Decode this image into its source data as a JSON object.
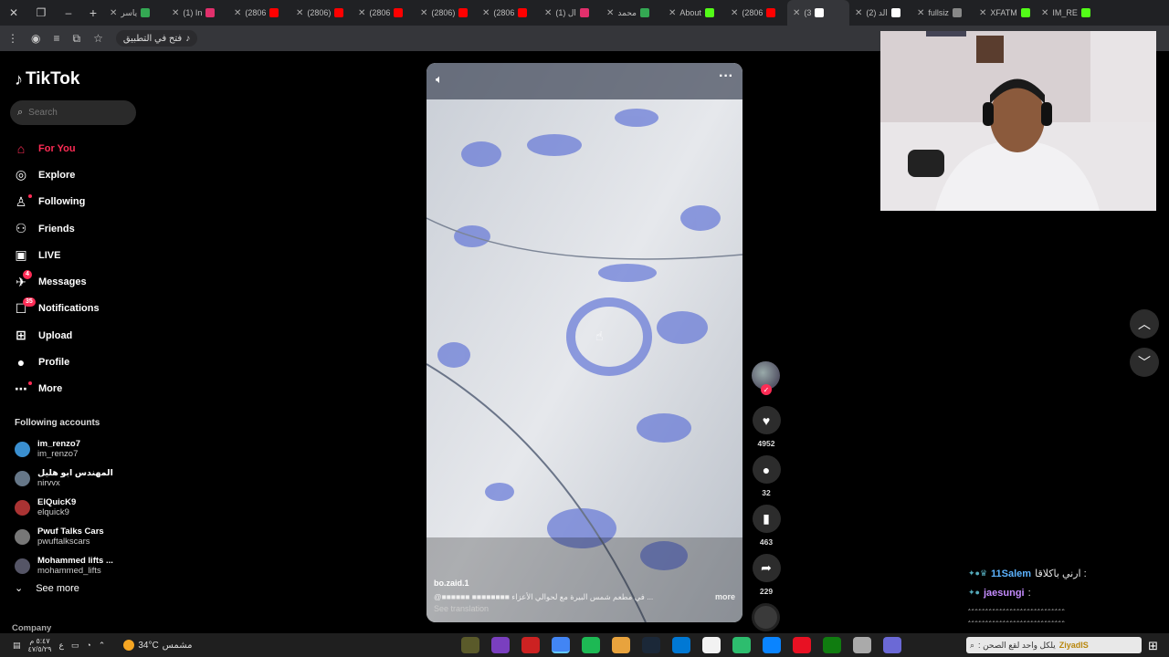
{
  "browser": {
    "tabs": [
      {
        "title": "ياسر",
        "favicon_color": "#34a853"
      },
      {
        "title": "(1) In",
        "favicon_color": "#e1306c"
      },
      {
        "title": "(2806",
        "favicon_color": "#ff0000"
      },
      {
        "title": "(2806)",
        "favicon_color": "#ff0000"
      },
      {
        "title": "(2806",
        "favicon_color": "#ff0000"
      },
      {
        "title": "(2806)",
        "favicon_color": "#ff0000"
      },
      {
        "title": "(2806",
        "favicon_color": "#ff0000"
      },
      {
        "title": "(1) ال",
        "favicon_color": "#e1306c"
      },
      {
        "title": "محمد",
        "favicon_color": "#34a853"
      },
      {
        "title": "About",
        "favicon_color": "#53fc18"
      },
      {
        "title": "(2806",
        "favicon_color": "#ff0000"
      },
      {
        "title": "(3",
        "favicon_color": "#ffffff",
        "active": true
      },
      {
        "title": "(2) الد",
        "favicon_color": "#ffffff"
      },
      {
        "title": "fullsiz",
        "favicon_color": "#888888"
      },
      {
        "title": "XFATM",
        "favicon_color": "#53fc18"
      },
      {
        "title": "IM_RE",
        "favicon_color": "#53fc18"
      }
    ],
    "open_in_app_label": "فتح في التطبيق"
  },
  "tiktok": {
    "logo_text": "TikTok",
    "search_placeholder": "Search",
    "nav": [
      {
        "label": "For You",
        "icon": "home-icon",
        "glyph": "⌂",
        "active": true
      },
      {
        "label": "Explore",
        "icon": "compass-icon",
        "glyph": "◎"
      },
      {
        "label": "Following",
        "icon": "following-icon",
        "glyph": "♙",
        "dot": true
      },
      {
        "label": "Friends",
        "icon": "friends-icon",
        "glyph": "⚇"
      },
      {
        "label": "LIVE",
        "icon": "live-icon",
        "glyph": "▣"
      },
      {
        "label": "Messages",
        "icon": "messages-icon",
        "glyph": "✈",
        "badge": "4"
      },
      {
        "label": "Notifications",
        "icon": "notifications-icon",
        "glyph": "☐",
        "badge": "35"
      },
      {
        "label": "Upload",
        "icon": "upload-icon",
        "glyph": "⊞"
      },
      {
        "label": "Profile",
        "icon": "profile-icon",
        "glyph": "●"
      },
      {
        "label": "More",
        "icon": "more-icon",
        "glyph": "⋯",
        "dot": true
      }
    ],
    "following_title": "Following accounts",
    "accounts": [
      {
        "name": "im_renzo7",
        "handle": "im_renzo7"
      },
      {
        "name": "المهندس ابو هليل",
        "handle": "nirvvx"
      },
      {
        "name": "ElQuicK9",
        "handle": "elquick9"
      },
      {
        "name": "Pwuf Talks Cars",
        "handle": "pwuftalkscars"
      },
      {
        "name": "Mohammed lifts ...",
        "handle": "mohammed_lifts"
      }
    ],
    "see_more": "See more",
    "company": "Company",
    "video": {
      "username": "bo.zaid.1",
      "description": "@■■■■■■ ■■■■■■■■ في مطعم شمس البيرة مع لحوالي الأعزاء ...",
      "more": "more",
      "see_translation": "See translation"
    },
    "actions": {
      "likes": "4952",
      "comments": "32",
      "saves": "463",
      "shares": "229"
    }
  },
  "chat": {
    "line1_user": "11Salem",
    "line1_msg": "ارني باكلاقا :",
    "line2_user": "jaesungi",
    "line2_msg": ":",
    "spam1": "ۦۦۦۦۦۦۦۦۦۦۦۦۦۦۦۦۦۦۦۦۦۦۦۦۦۦۦۦ",
    "spam2": "ۦۦۦۦۦۦۦۦۦۦۦۦۦۦۦۦۦۦۦۦۦۦۦۦۦۦۦۦ",
    "tray_user": "ZiyadIS",
    "tray_msg": ": يلكل واحد لقع الصحن"
  },
  "taskbar": {
    "time": "٥:٤٧ م",
    "date": "٤٧/٥/٢٩",
    "lang": "ع",
    "temperature": "34°C",
    "weather_text": "مشمس",
    "apps": [
      "#5a5a2a",
      "#7a3fbf",
      "#cc2222",
      "#4285f4",
      "#1db954",
      "#e8a33d",
      "#1b2838",
      "#0078d4",
      "#f2f2f2",
      "#2dbd6e",
      "#0a84ff",
      "#e81123",
      "#107c10",
      "#aaaaaa",
      "#6b69d6"
    ]
  }
}
